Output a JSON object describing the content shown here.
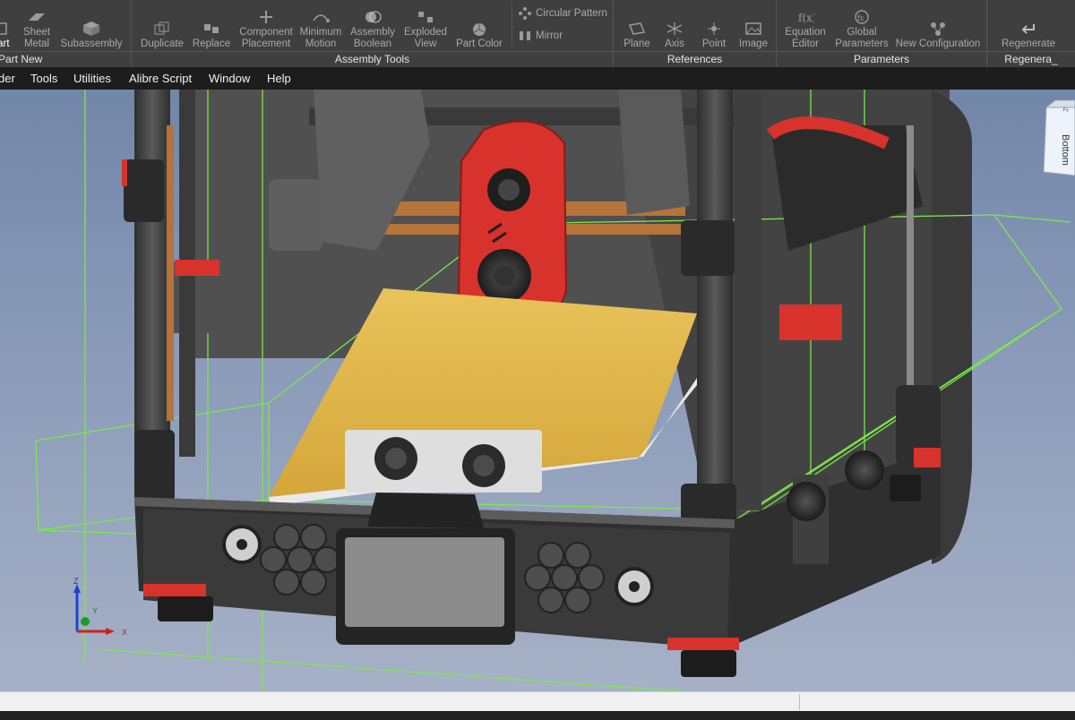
{
  "ribbon": {
    "new_group": {
      "label": "Part New",
      "buttons": [
        {
          "label": "Part"
        },
        {
          "label": "Sheet\nMetal"
        },
        {
          "label": "Subassembly"
        }
      ]
    },
    "assembly_tools": {
      "label": "Assembly Tools",
      "buttons": [
        {
          "label": "Duplicate"
        },
        {
          "label": "Replace"
        },
        {
          "label": "Component\nPlacement"
        },
        {
          "label": "Minimum\nMotion"
        },
        {
          "label": "Assembly\nBoolean"
        },
        {
          "label": "Exploded\nView"
        },
        {
          "label": "Part Color"
        }
      ],
      "small_buttons": [
        {
          "label": "Circular Pattern"
        },
        {
          "label": "Mirror"
        }
      ]
    },
    "references": {
      "label": "References",
      "buttons": [
        {
          "label": "Plane"
        },
        {
          "label": "Axis"
        },
        {
          "label": "Point"
        },
        {
          "label": "Image"
        }
      ]
    },
    "parameters": {
      "label": "Parameters",
      "buttons": [
        {
          "label": "Equation\nEditor"
        },
        {
          "label": "Global\nParameters"
        },
        {
          "label": "New Configuration"
        }
      ]
    },
    "regenerate": {
      "label": "Regenera_",
      "buttons": [
        {
          "label": "Regenerate"
        }
      ]
    }
  },
  "menu": {
    "items": [
      "der",
      "Tools",
      "Utilities",
      "Alibre Script",
      "Window",
      "Help"
    ]
  },
  "viewport": {
    "view_cube_faces": [
      "Bottom",
      "Fr"
    ],
    "axis_triad": {
      "x": "X",
      "y": "Y",
      "z": "Z"
    }
  },
  "colors": {
    "ribbon_bg": "#3f3f3f",
    "menu_bg": "#1d1d1d",
    "viewport_top": "#7286a9",
    "viewport_bottom": "#a6b1c6",
    "reference_plane": "#7be84a",
    "printer_frame": "#3c3c3c",
    "accent_red": "#d8322c",
    "bed": "#e1b645",
    "bed_frame": "#e9e9e9",
    "rail_copper": "#b6733a"
  }
}
